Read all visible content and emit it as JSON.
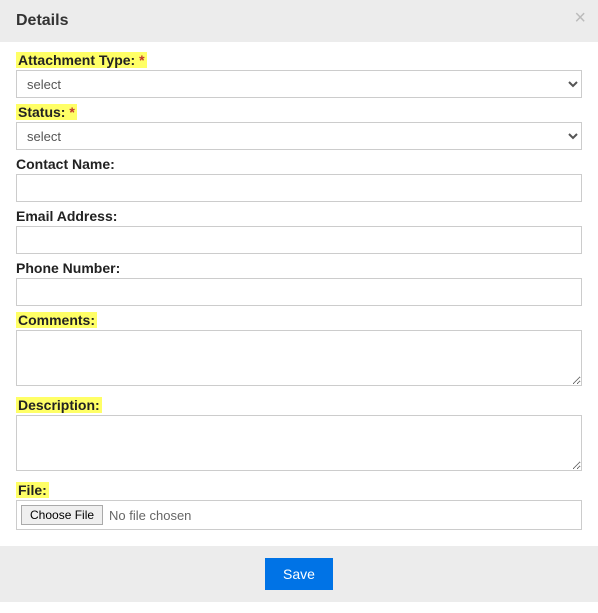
{
  "header": {
    "title": "Details"
  },
  "fields": {
    "attachment_type": {
      "label": "Attachment Type:",
      "required": "*",
      "selected": "select"
    },
    "status": {
      "label": "Status:",
      "required": "*",
      "selected": "select"
    },
    "contact_name": {
      "label": "Contact Name:",
      "value": ""
    },
    "email_address": {
      "label": "Email Address:",
      "value": ""
    },
    "phone_number": {
      "label": "Phone Number:",
      "value": ""
    },
    "comments": {
      "label": "Comments:",
      "value": ""
    },
    "description": {
      "label": "Description:",
      "value": ""
    },
    "file": {
      "label": "File:",
      "button": "Choose File",
      "status": "No file chosen"
    }
  },
  "footer": {
    "save_label": "Save"
  }
}
